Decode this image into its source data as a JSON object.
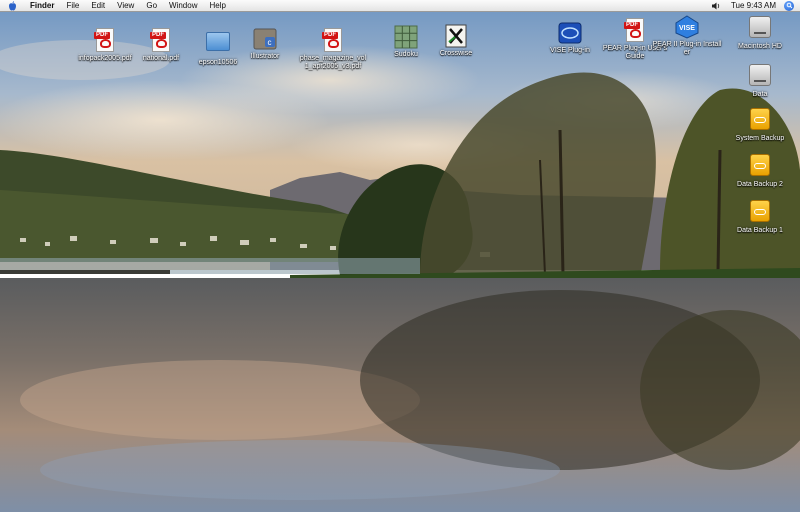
{
  "menubar": {
    "app_name": "Finder",
    "items": [
      "File",
      "Edit",
      "View",
      "Go",
      "Window",
      "Help"
    ],
    "clock": "Tue 9:43 AM"
  },
  "desktop": {
    "icons": [
      {
        "label": "infopack2005.pdf",
        "type": "pdf-icon"
      },
      {
        "label": "national.pdf",
        "type": "pdf-icon"
      },
      {
        "label": "epson10506",
        "type": "folder-icon"
      },
      {
        "label": "Illustrator",
        "type": "app-icon"
      },
      {
        "label": "phase_magazine_vol1_apr2005_v3.pdf",
        "type": "pdf-icon"
      },
      {
        "label": "Sudoku",
        "type": "app-icon"
      },
      {
        "label": "Crosswise",
        "type": "app-icon"
      },
      {
        "label": "VISE Plug-in",
        "type": "app-icon"
      },
      {
        "label": "PEAR Plug-in User's Guide",
        "type": "pdf-icon"
      },
      {
        "label": "PEAR II Plug-in Installer",
        "type": "installer-icon"
      },
      {
        "label": "Macintosh HD",
        "type": "hard-disk-icon"
      },
      {
        "label": "Data",
        "type": "hard-disk-icon"
      },
      {
        "label": "System Backup",
        "type": "backup-disk-icon"
      },
      {
        "label": "Data Backup 2",
        "type": "backup-disk-icon"
      },
      {
        "label": "Data Backup 1",
        "type": "backup-disk-icon"
      }
    ]
  }
}
